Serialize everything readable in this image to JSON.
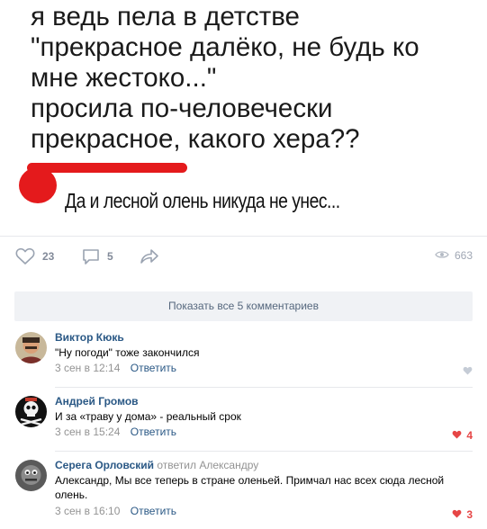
{
  "meme": {
    "main_text": "я ведь пела в детстве\n\"прекрасное далёко, не будь ко\nмне жестоко...\"\nпросила по-человечески\nпрекрасное, какого хера??",
    "handwritten_reply": "Да и лесной олень никуда не унес...",
    "accent_color": "#e41a1c"
  },
  "actions": {
    "likes": "23",
    "comments": "5",
    "views": "663",
    "like_icon": "heart-outline-icon",
    "comment_icon": "comment-bubble-icon",
    "share_icon": "share-arrow-icon",
    "views_icon": "eye-icon"
  },
  "show_all_label": "Показать все 5 комментариев",
  "comments": [
    {
      "author": "Виктор Кюкь",
      "reply_to": "",
      "text": "\"Ну погоди\" тоже закончился",
      "time": "3 сен в 12:14",
      "reply_label": "Ответить",
      "likes": ""
    },
    {
      "author": "Андрей Громов",
      "reply_to": "",
      "text": "И за «траву у дома» - реальный срок",
      "time": "3 сен в 15:24",
      "reply_label": "Ответить",
      "likes": "4"
    },
    {
      "author": "Серега Орловский",
      "reply_to": "ответил Александру",
      "text": "Александр, Мы все теперь в стране оленьей. Примчал нас всех сюда лесной олень.",
      "time": "3 сен в 16:10",
      "reply_label": "Ответить",
      "likes": "3"
    }
  ],
  "colors": {
    "link": "#2a5885",
    "muted": "#939393",
    "like_active": "#e64646",
    "button_bg": "#f0f2f5"
  }
}
